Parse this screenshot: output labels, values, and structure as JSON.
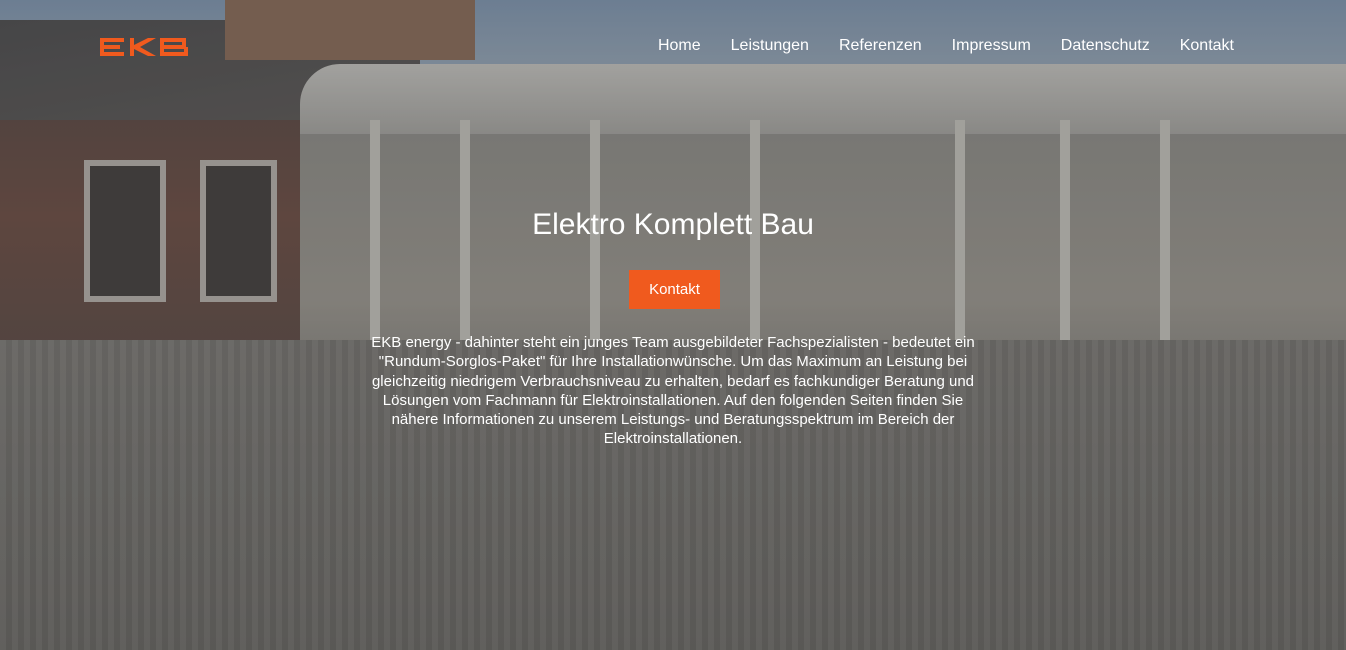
{
  "brand": {
    "logo_text": "EKB",
    "accent_color": "#f05a1e"
  },
  "nav": {
    "items": [
      {
        "label": "Home"
      },
      {
        "label": "Leistungen"
      },
      {
        "label": "Referenzen"
      },
      {
        "label": "Impressum"
      },
      {
        "label": "Datenschutz"
      },
      {
        "label": "Kontakt"
      }
    ]
  },
  "hero": {
    "title": "Elektro Komplett Bau",
    "cta_label": "Kontakt",
    "text": "EKB energy - dahinter steht ein junges Team ausgebildeter Fachspezialisten - bedeutet ein \"Rundum-Sorglos-Paket\" für Ihre Installationwünsche. Um das Maximum an Leistung bei gleichzeitig niedrigem Verbrauchsniveau zu erhalten, bedarf es fachkundiger Beratung und Lösungen vom Fachmann für Elektroinstallationen. Auf den folgenden Seiten finden Sie nähere Informationen zu unserem Leistungs- und Beratungsspektrum im Bereich der Elektroinstallationen."
  }
}
